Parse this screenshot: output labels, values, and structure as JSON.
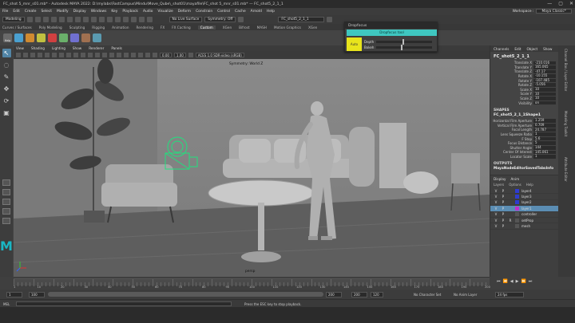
{
  "window": {
    "title": "FC_shot 5_mnr_s01.mb* - Autodesk MAYA 2022: D:\\mylabs\\FastCampus\\Mindu\\Move_Qube\\_shot01\\mayafile\\FC_shot 5_mnr_s01.mb* — FC_shot5_2_1_1",
    "minimize": "—",
    "maximize": "▢",
    "close": "✕"
  },
  "menubar": {
    "items": [
      "File",
      "Edit",
      "Create",
      "Select",
      "Modify",
      "Display",
      "Windows",
      "Key",
      "Playback",
      "Audio",
      "Visualize",
      "Deform",
      "Constrain",
      "Control",
      "Cache",
      "Arnold",
      "Help"
    ],
    "workspace_label": "Workspace :",
    "workspace_value": "Maya Classic*"
  },
  "statusline": {
    "mode": "Modeling",
    "no_live_surface": "No Live Surface",
    "symmetry": "Symmetry: Off",
    "object_name": "FC_shot5_2_1_1"
  },
  "shelf": {
    "tabs": [
      "Curves / Surfaces",
      "Poly Modeling",
      "Sculpting",
      "Rigging",
      "Animation",
      "Rendering",
      "FX",
      "FX Caching",
      "Custom",
      "XGen",
      "Bifrost",
      "MASH",
      "Motion Graphics",
      "XGen"
    ],
    "active_tab": "Custom",
    "icons": [
      {
        "label": "Help",
        "color": "#6a6a6a"
      },
      {
        "label": "",
        "color": "#4aa0d0"
      },
      {
        "label": "",
        "color": "#d08a30"
      },
      {
        "label": "",
        "color": "#c0c040"
      },
      {
        "label": "",
        "color": "#d04040"
      },
      {
        "label": "",
        "color": "#6ab06a"
      },
      {
        "label": "",
        "color": "#7070d0"
      },
      {
        "label": "",
        "color": "#a07050"
      },
      {
        "label": "",
        "color": "#5a9ab0"
      }
    ]
  },
  "panel": {
    "menus": [
      "View",
      "Shading",
      "Lighting",
      "Show",
      "Renderer",
      "Panels"
    ],
    "value_near": "0.00",
    "value_far": "1.00",
    "colorspace": "ACES 1.0 SDR-video (sRGB)",
    "symmetry_label": "Symmetry: World Z",
    "camera_label": "persp"
  },
  "attribute_editor": {
    "tabs": [
      "Channels",
      "Edit",
      "Object",
      "Show"
    ],
    "node": "FC_shot5_2_1_1",
    "transform": [
      {
        "label": "Translate X",
        "value": "-210.016"
      },
      {
        "label": "Translate Y",
        "value": "165.065"
      },
      {
        "label": "Translate Z",
        "value": "-47.17"
      },
      {
        "label": "Rotate X",
        "value": "-10.155"
      },
      {
        "label": "Rotate Y",
        "value": "-107.485"
      },
      {
        "label": "Rotate Z",
        "value": "-5.056"
      },
      {
        "label": "Scale X",
        "value": "10"
      },
      {
        "label": "Scale Y",
        "value": "10"
      },
      {
        "label": "Scale Z",
        "value": "10"
      },
      {
        "label": "Visibility",
        "value": "on"
      }
    ],
    "shapes_header": "SHAPES",
    "shape_node": "FC_shot5_2_1_1Shape1",
    "shape_attrs": [
      {
        "label": "Horizontal Film Aperture",
        "value": "1.259"
      },
      {
        "label": "Vertical Film Aperture",
        "value": "0.709"
      },
      {
        "label": "Focal Length",
        "value": "24.787"
      },
      {
        "label": "Lens Squeeze Ratio",
        "value": "1"
      },
      {
        "label": "F Stop",
        "value": "5.6"
      },
      {
        "label": "Focus Distance",
        "value": "5"
      },
      {
        "label": "Shutter Angle",
        "value": "144"
      },
      {
        "label": "Center Of Interest",
        "value": "145.061"
      },
      {
        "label": "Locator Scale",
        "value": "1"
      }
    ],
    "outputs_header": "OUTPUTS",
    "output_node": "MayaNodeEditorSavedTabsInfo"
  },
  "layers": {
    "tabs": [
      "Display",
      "Anim"
    ],
    "menus": [
      "Layers",
      "Options",
      "Help"
    ],
    "rows": [
      {
        "v": "V",
        "p": "P",
        "r": "",
        "color": "#2e3ccf",
        "name": "layer4",
        "selected": false
      },
      {
        "v": "V",
        "p": "P",
        "r": "",
        "color": "#2e3ccf",
        "name": "layer3",
        "selected": false
      },
      {
        "v": "V",
        "p": "P",
        "r": "",
        "color": "#2e3ccf",
        "name": "layer2",
        "selected": false
      },
      {
        "v": "V",
        "p": "P",
        "r": "",
        "color": "#c02fd0",
        "name": "layer1",
        "selected": true
      },
      {
        "v": "V",
        "p": "P",
        "r": "",
        "color": "#555555",
        "name": "controller",
        "selected": false
      },
      {
        "v": "V",
        "p": "P",
        "r": "R",
        "color": "#555555",
        "name": "setProp",
        "selected": false
      },
      {
        "v": "V",
        "p": "P",
        "r": "",
        "color": "#555555",
        "name": "mesh",
        "selected": false
      }
    ]
  },
  "side_tabs": [
    "Channel Box / Layer Editor",
    "Modeling Toolkit",
    "Attribute Editor"
  ],
  "timeline": {
    "ticks": [
      "1",
      "10",
      "20",
      "30",
      "40",
      "50",
      "60",
      "70",
      "80",
      "90",
      "100",
      "110",
      "120",
      "130",
      "140",
      "150",
      "160",
      "170",
      "180",
      "190",
      "200"
    ],
    "current_frame": "1"
  },
  "range": {
    "start": "1",
    "range_start": "100",
    "range_end": "200",
    "anim_end": "200",
    "end": "120",
    "character_set": "No Character Set",
    "anim_layer": "No Anim Layer",
    "fps": "24 fps"
  },
  "cmdline": {
    "lang": "MEL",
    "help": "Press the ESC key to stop playback."
  },
  "popup": {
    "title": "Dropfocus",
    "button": "Dropfocus tool",
    "swatch_label": "Auto",
    "depth_label": "Depth",
    "depth_value": 0.48,
    "bokeh_label": "Bokeh",
    "bokeh_value": 0.45
  },
  "colors": {
    "accent": "#1ab6c4",
    "selection": "#5285a6",
    "popup_button": "#3fc7c0",
    "popup_swatch": "#e8e41c",
    "camera_icon": "#21e07e"
  }
}
